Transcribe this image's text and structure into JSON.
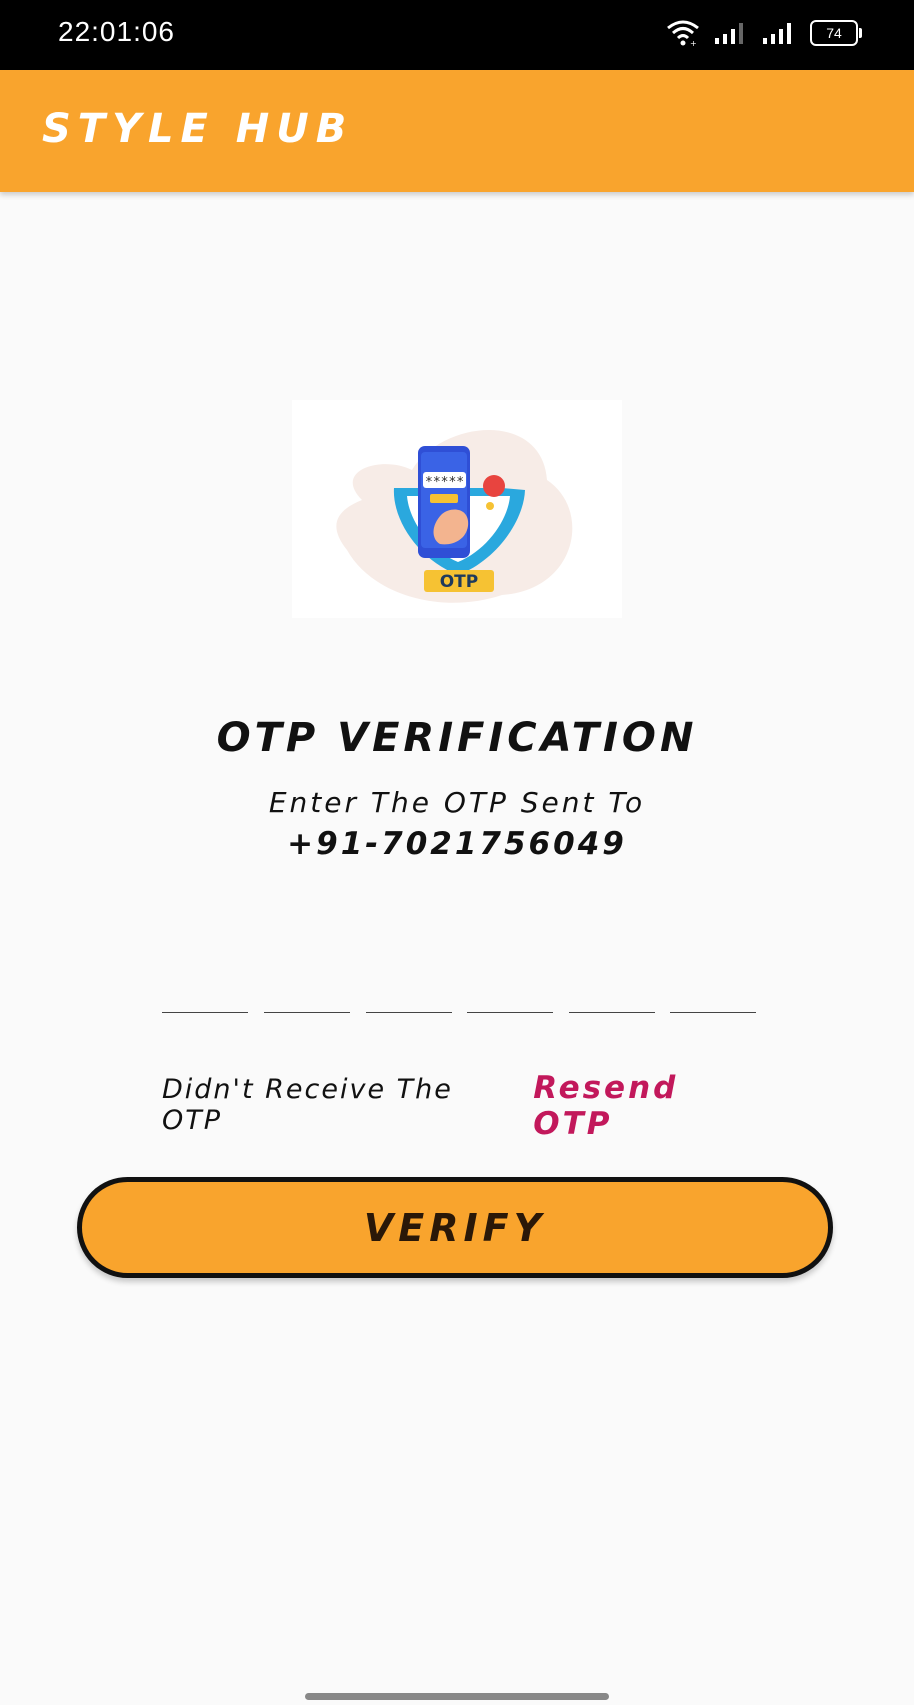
{
  "status_bar": {
    "time": "22:01:06",
    "battery": "74",
    "icons": [
      "wifi-icon",
      "signal-icon",
      "signal-icon",
      "battery-icon"
    ]
  },
  "app_bar": {
    "title": "STYLE HUB",
    "color": "#f9a42d"
  },
  "illustration": {
    "badge_text": "OTP",
    "screen_text": "*****"
  },
  "content": {
    "title": "OTP VERIFICATION",
    "subtitle": "Enter The OTP Sent To",
    "phone": "+91-7021756049"
  },
  "otp": {
    "digits": [
      "",
      "",
      "",
      "",
      "",
      ""
    ]
  },
  "resend": {
    "prompt": "Didn't Receive The OTP",
    "link": "Resend OTP",
    "link_color": "#c2185b"
  },
  "verify": {
    "label": "VERIFY",
    "color": "#f9a42d"
  }
}
